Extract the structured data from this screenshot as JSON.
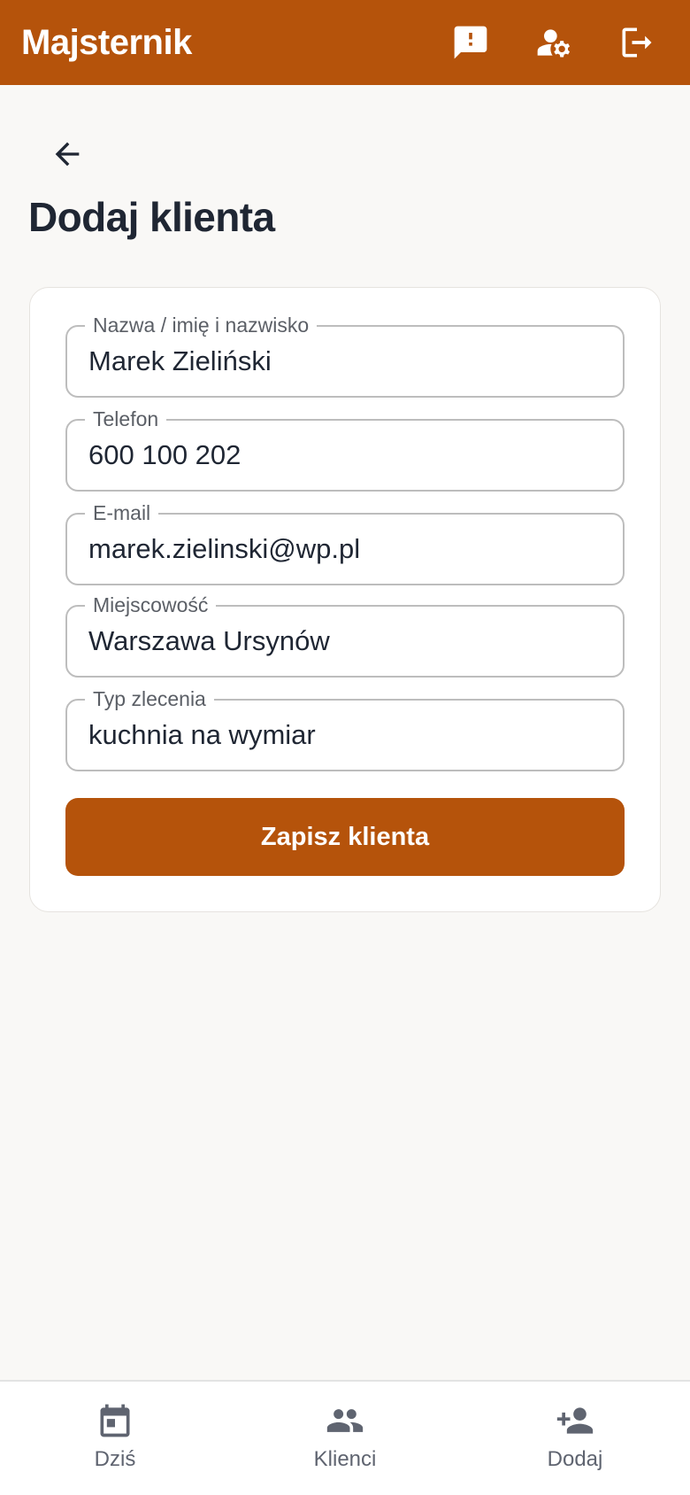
{
  "appbar": {
    "title": "Majsternik",
    "icons": [
      "feedback-icon",
      "user-settings-icon",
      "logout-icon"
    ]
  },
  "page": {
    "title": "Dodaj klienta"
  },
  "form": {
    "fields": [
      {
        "label": "Nazwa / imię i nazwisko",
        "value": "Marek Zieliński"
      },
      {
        "label": "Telefon",
        "value": "600 100 202"
      },
      {
        "label": "E-mail",
        "value": "marek.zielinski@wp.pl"
      },
      {
        "label": "Miejscowość",
        "value": "Warszawa Ursynów"
      },
      {
        "label": "Typ zlecenia",
        "value": "kuchnia na wymiar"
      }
    ],
    "submit_label": "Zapisz klienta"
  },
  "nav": {
    "items": [
      {
        "label": "Dziś",
        "icon": "calendar-icon"
      },
      {
        "label": "Klienci",
        "icon": "people-icon"
      },
      {
        "label": "Dodaj",
        "icon": "person-add-icon"
      }
    ]
  },
  "colors": {
    "primary": "#b5530b",
    "text": "#1f2633",
    "background": "#f9f8f6"
  }
}
